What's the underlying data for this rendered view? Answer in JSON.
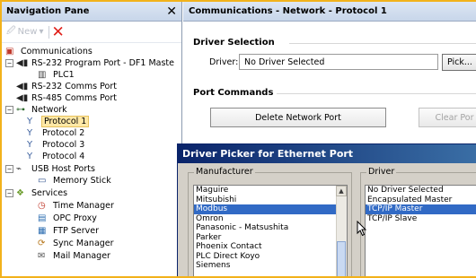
{
  "nav": {
    "title": "Navigation Pane",
    "new_label": "New"
  },
  "tree": [
    {
      "label": "Communications",
      "icon": "comms-icon"
    },
    {
      "label": "RS-232 Program Port - DF1 Maste",
      "icon": "serial-port-icon"
    },
    {
      "label": "PLC1",
      "icon": "plc-icon"
    },
    {
      "label": "RS-232 Comms Port",
      "icon": "serial-port-icon"
    },
    {
      "label": "RS-485 Comms Port",
      "icon": "serial-port-icon"
    },
    {
      "label": "Network",
      "icon": "network-icon"
    },
    {
      "label": "Protocol 1",
      "icon": "protocol-icon"
    },
    {
      "label": "Protocol 2",
      "icon": "protocol-icon"
    },
    {
      "label": "Protocol 3",
      "icon": "protocol-icon"
    },
    {
      "label": "Protocol 4",
      "icon": "protocol-icon"
    },
    {
      "label": "USB Host Ports",
      "icon": "usb-icon"
    },
    {
      "label": "Memory Stick",
      "icon": "memory-stick-icon"
    },
    {
      "label": "Services",
      "icon": "services-icon"
    },
    {
      "label": "Time Manager",
      "icon": "time-manager-icon"
    },
    {
      "label": "OPC Proxy",
      "icon": "opc-proxy-icon"
    },
    {
      "label": "FTP Server",
      "icon": "ftp-server-icon"
    },
    {
      "label": "Sync Manager",
      "icon": "sync-manager-icon"
    },
    {
      "label": "Mail Manager",
      "icon": "mail-manager-icon"
    }
  ],
  "main": {
    "title": "Communications - Network - Protocol 1",
    "driver_section": "Driver Selection",
    "driver_label": "Driver:",
    "driver_value": "No Driver Selected",
    "pick_label": "Pick...",
    "port_section": "Port Commands",
    "delete_label": "Delete Network Port",
    "clear_label": "Clear Por"
  },
  "dialog": {
    "title": "Driver Picker for Ethernet Port",
    "manufacturer_label": "Manufacturer",
    "driver_label": "Driver",
    "manufacturers": [
      "Maguire",
      "Mitsubishi",
      "Modbus",
      "Omron",
      "Panasonic - Matsushita",
      "Parker",
      "Phoenix Contact",
      "PLC Direct Koyo",
      "Siemens"
    ],
    "selected_manufacturer": "Modbus",
    "drivers": [
      "No Driver Selected",
      "Encapsulated Master",
      "TCP/IP Master",
      "TCP/IP Slave"
    ],
    "selected_driver": "TCP/IP Master"
  },
  "colors": {
    "frame_border": "#f2b21b",
    "selection_blue": "#316ac5",
    "tree_selection": "#ffe8a6",
    "delete_red": "#e0201a",
    "dialog_title": "#0a246a"
  }
}
